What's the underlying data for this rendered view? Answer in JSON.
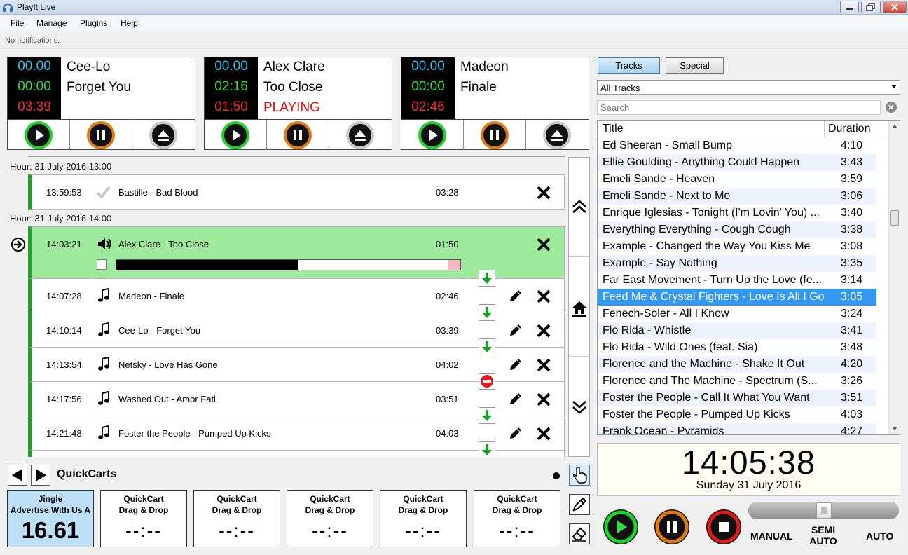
{
  "window": {
    "title": "PlayIt Live",
    "min": "0",
    "max": "1",
    "close": "r"
  },
  "menu": {
    "file": "File",
    "manage": "Manage",
    "plugins": "Plugins",
    "help": "Help"
  },
  "notification": "No notifications.",
  "players": [
    {
      "elapsed": "00.00",
      "intro": "00:00",
      "remaining": "03:39",
      "artist": "Cee-Lo",
      "title": "Forget You",
      "status": ""
    },
    {
      "elapsed": "00.00",
      "intro": "02:16",
      "remaining": "01:50",
      "artist": "Alex Clare",
      "title": "Too Close",
      "status": "PLAYING"
    },
    {
      "elapsed": "00.00",
      "intro": "00:00",
      "remaining": "02:46",
      "artist": "Madeon",
      "title": "Finale",
      "status": ""
    }
  ],
  "log": {
    "hour1": "Hour: 31 July 2016 13:00",
    "hour2": "Hour: 31 July 2016 14:00",
    "items": [
      {
        "time": "13:59:53",
        "name": "Bastille - Bad Blood",
        "duration": "03:28"
      },
      {
        "time": "14:03:21",
        "name": "Alex Clare - Too Close",
        "duration": "01:50",
        "progress": 0.53
      },
      {
        "time": "14:07:28",
        "name": "Madeon - Finale",
        "duration": "02:46"
      },
      {
        "time": "14:10:14",
        "name": "Cee-Lo - Forget You",
        "duration": "03:39"
      },
      {
        "time": "14:13:54",
        "name": "Netsky - Love Has Gone",
        "duration": "04:02"
      },
      {
        "time": "14:17:56",
        "name": "Washed Out - Amor Fati",
        "duration": "03:51"
      },
      {
        "time": "14:21:48",
        "name": "Foster the People - Pumped Up Kicks",
        "duration": "04:03"
      }
    ]
  },
  "quickcarts": {
    "title": "QuickCarts",
    "carts": [
      {
        "line1": "Jingle",
        "line2": "Advertise With Us A",
        "value": "16.61"
      },
      {
        "line1": "QuickCart",
        "line2": "Drag & Drop",
        "value": "--:--"
      },
      {
        "line1": "QuickCart",
        "line2": "Drag & Drop",
        "value": "--:--"
      },
      {
        "line1": "QuickCart",
        "line2": "Drag & Drop",
        "value": "--:--"
      },
      {
        "line1": "QuickCart",
        "line2": "Drag & Drop",
        "value": "--:--"
      },
      {
        "line1": "QuickCart",
        "line2": "Drag & Drop",
        "value": "--:--"
      }
    ]
  },
  "library": {
    "tab_tracks": "Tracks",
    "tab_special": "Special",
    "filter": "All Tracks",
    "search_placeholder": "Search",
    "col_title": "Title",
    "col_duration": "Duration",
    "rows": [
      {
        "title": "Ed Sheeran - Small Bump",
        "duration": "4:10"
      },
      {
        "title": "Ellie Goulding - Anything Could Happen",
        "duration": "3:43"
      },
      {
        "title": "Emeli Sande - Heaven",
        "duration": "3:59"
      },
      {
        "title": "Emeli Sande - Next to Me",
        "duration": "3:06"
      },
      {
        "title": "Enrique Iglesias - Tonight (I'm Lovin' You) ...",
        "duration": "3:40"
      },
      {
        "title": "Everything Everything - Cough Cough",
        "duration": "3:38"
      },
      {
        "title": "Example - Changed the Way You Kiss Me",
        "duration": "3:08"
      },
      {
        "title": "Example - Say Nothing",
        "duration": "3:35"
      },
      {
        "title": "Far East Movement - Turn Up the Love (fe...",
        "duration": "3:14"
      },
      {
        "title": "Feed Me & Crystal Fighters - Love Is All I Got",
        "duration": "3:05"
      },
      {
        "title": "Fenech-Soler - All I Know",
        "duration": "3:24"
      },
      {
        "title": "Flo Rida - Whistle",
        "duration": "3:41"
      },
      {
        "title": "Flo Rida - Wild Ones (feat. Sia)",
        "duration": "3:48"
      },
      {
        "title": "Florence and the Machine - Shake It Out",
        "duration": "4:20"
      },
      {
        "title": "Florence and The Machine - Spectrum (S...",
        "duration": "3:26"
      },
      {
        "title": "Foster the People - Call It What You Want",
        "duration": "3:51"
      },
      {
        "title": "Foster the People - Pumped Up Kicks",
        "duration": "4:03"
      },
      {
        "title": "Frank Ocean - Pyramids",
        "duration": "4:27"
      }
    ]
  },
  "clock": {
    "time": "14:05:38",
    "date": "Sunday 31 July 2016"
  },
  "modes": {
    "manual": "MANUAL",
    "semi1": "SEMI",
    "semi2": "AUTO",
    "auto": "AUTO",
    "level": 0.5
  },
  "colors": {
    "cyan": "#27c6ee",
    "green": "#2fdc3a",
    "red": "#ff2a2a",
    "playing_bg": "#9dea9d",
    "selection": "#3498f0"
  }
}
